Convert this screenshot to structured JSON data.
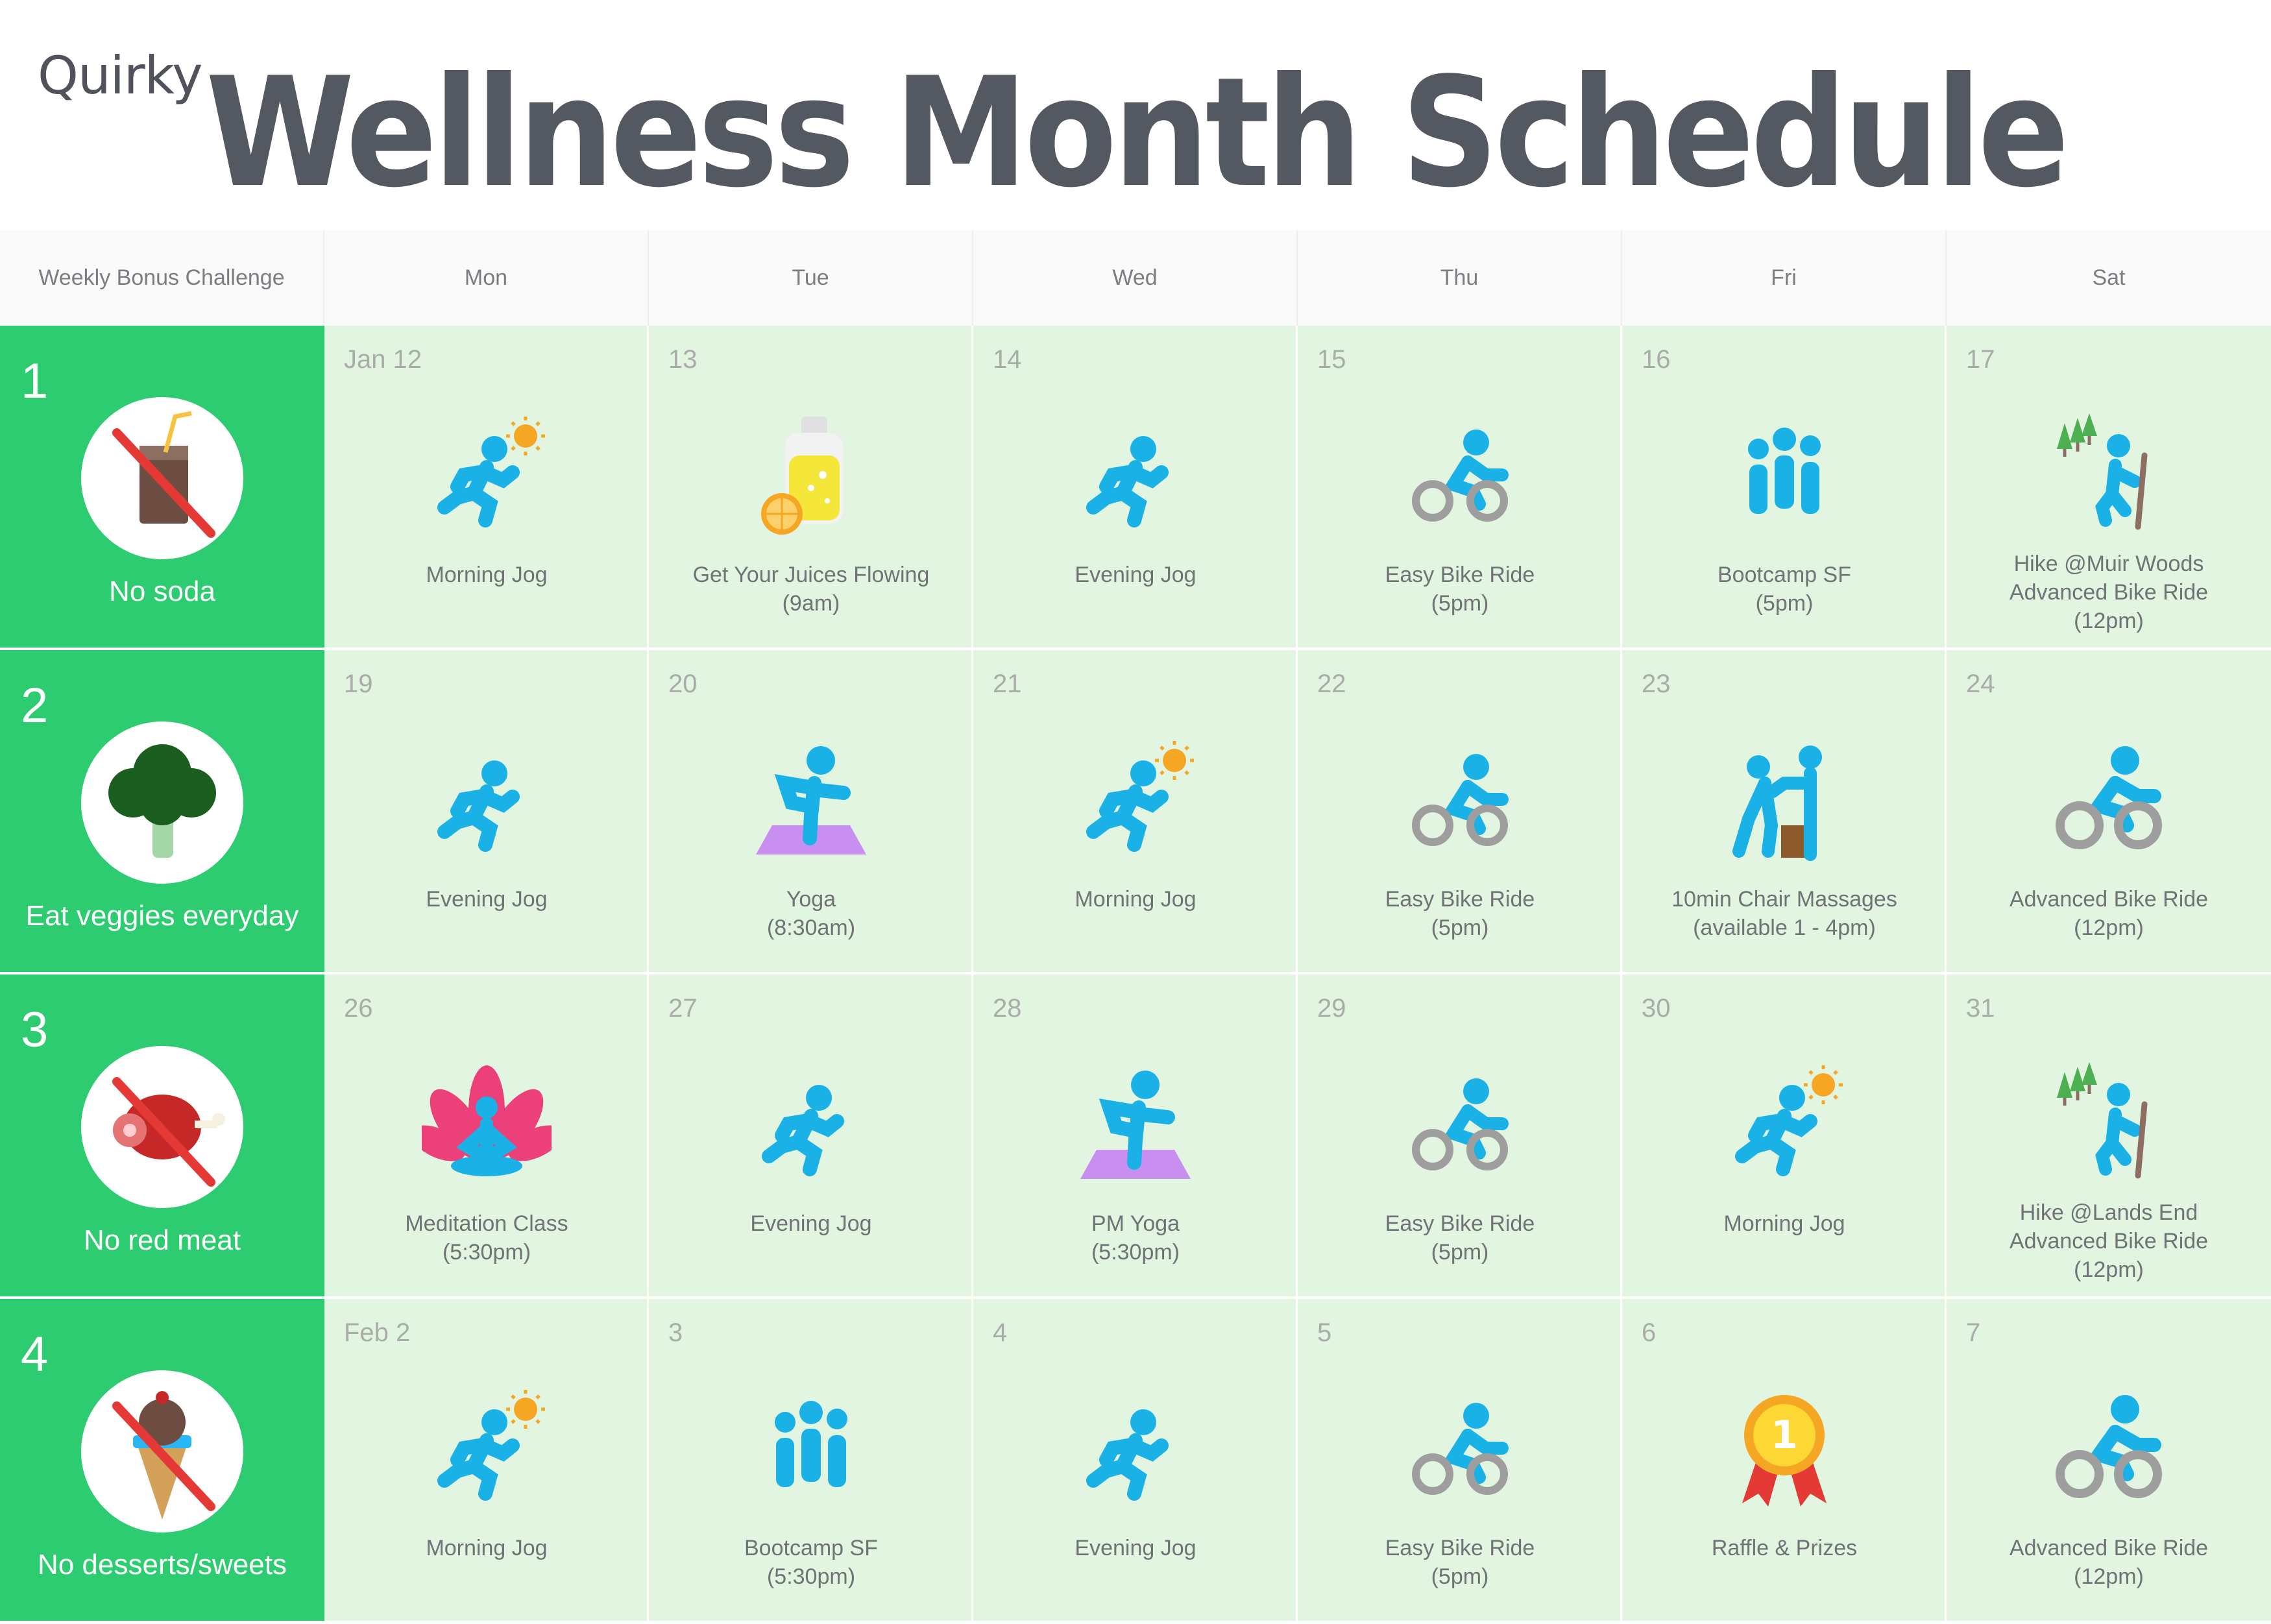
{
  "brand": "Quirky",
  "title": "Wellness Month Schedule",
  "header": [
    "Weekly Bonus Challenge",
    "Mon",
    "Tue",
    "Wed",
    "Thu",
    "Fri",
    "Sat"
  ],
  "colors": {
    "challenge_green": "#2ecc71",
    "cell_green": "#e1f5e1",
    "figure_blue": "#1ab1e6",
    "title_gray": "#545861"
  },
  "weeks": [
    {
      "number": "1",
      "challenge": "No soda",
      "challenge_icon": "no-soda-icon",
      "days": [
        {
          "date": "Jan 12",
          "icon": "morning-jog-icon",
          "lines": [
            "Morning Jog"
          ]
        },
        {
          "date": "13",
          "icon": "juice-icon",
          "lines": [
            "Get Your Juices Flowing",
            "(9am)"
          ]
        },
        {
          "date": "14",
          "icon": "evening-jog-icon",
          "lines": [
            "Evening Jog"
          ]
        },
        {
          "date": "15",
          "icon": "bike-icon",
          "lines": [
            "Easy Bike Ride",
            "(5pm)"
          ]
        },
        {
          "date": "16",
          "icon": "bootcamp-icon",
          "lines": [
            "Bootcamp SF",
            "(5pm)"
          ]
        },
        {
          "date": "17",
          "icon": "hike-icon",
          "lines": [
            "Hike @Muir Woods",
            "Advanced Bike Ride",
            "(12pm)"
          ]
        }
      ]
    },
    {
      "number": "2",
      "challenge": "Eat veggies everyday",
      "challenge_icon": "broccoli-icon",
      "days": [
        {
          "date": "19",
          "icon": "evening-jog-icon",
          "lines": [
            "Evening Jog"
          ]
        },
        {
          "date": "20",
          "icon": "yoga-icon",
          "lines": [
            "Yoga",
            "(8:30am)"
          ]
        },
        {
          "date": "21",
          "icon": "morning-jog-icon",
          "lines": [
            "Morning Jog"
          ]
        },
        {
          "date": "22",
          "icon": "bike-icon",
          "lines": [
            "Easy Bike Ride",
            "(5pm)"
          ]
        },
        {
          "date": "23",
          "icon": "massage-icon",
          "lines": [
            "10min Chair Massages",
            "(available 1 - 4pm)"
          ]
        },
        {
          "date": "24",
          "icon": "advanced-bike-icon",
          "lines": [
            "Advanced Bike Ride",
            "(12pm)"
          ]
        }
      ]
    },
    {
      "number": "3",
      "challenge": "No red meat",
      "challenge_icon": "no-red-meat-icon",
      "days": [
        {
          "date": "26",
          "icon": "meditation-icon",
          "lines": [
            "Meditation Class",
            "(5:30pm)"
          ]
        },
        {
          "date": "27",
          "icon": "evening-jog-icon",
          "lines": [
            "Evening Jog"
          ]
        },
        {
          "date": "28",
          "icon": "yoga-icon",
          "lines": [
            "PM Yoga",
            "(5:30pm)"
          ]
        },
        {
          "date": "29",
          "icon": "bike-icon",
          "lines": [
            "Easy Bike Ride",
            "(5pm)"
          ]
        },
        {
          "date": "30",
          "icon": "morning-jog-icon",
          "lines": [
            "Morning Jog"
          ]
        },
        {
          "date": "31",
          "icon": "hike-icon",
          "lines": [
            "Hike @Lands End",
            "Advanced Bike Ride",
            "(12pm)"
          ]
        }
      ]
    },
    {
      "number": "4",
      "challenge": "No desserts/sweets",
      "challenge_icon": "no-desserts-icon",
      "days": [
        {
          "date": "Feb 2",
          "icon": "morning-jog-icon",
          "lines": [
            "Morning Jog"
          ]
        },
        {
          "date": "3",
          "icon": "bootcamp-icon",
          "lines": [
            "Bootcamp SF",
            "(5:30pm)"
          ]
        },
        {
          "date": "4",
          "icon": "evening-jog-icon",
          "lines": [
            "Evening Jog"
          ]
        },
        {
          "date": "5",
          "icon": "bike-icon",
          "lines": [
            "Easy Bike Ride",
            "(5pm)"
          ]
        },
        {
          "date": "6",
          "icon": "medal-icon",
          "lines": [
            "Raffle & Prizes"
          ]
        },
        {
          "date": "7",
          "icon": "advanced-bike-icon",
          "lines": [
            "Advanced Bike Ride",
            "(12pm)"
          ]
        }
      ]
    }
  ]
}
